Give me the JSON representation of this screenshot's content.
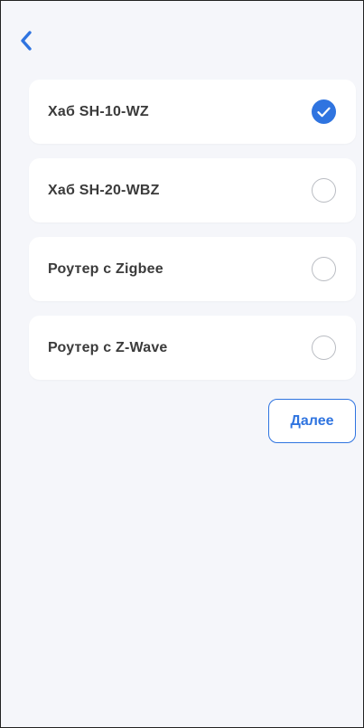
{
  "colors": {
    "accent": "#2f74e0",
    "background": "#f5f6fa",
    "card": "#ffffff",
    "text": "#3b3b3b"
  },
  "header": {
    "back_icon": "chevron-left-icon"
  },
  "options": [
    {
      "label": "Хаб SH-10-WZ",
      "selected": true
    },
    {
      "label": "Хаб SH-20-WBZ",
      "selected": false
    },
    {
      "label": "Роутер с Zigbee",
      "selected": false
    },
    {
      "label": "Роутер с Z-Wave",
      "selected": false
    }
  ],
  "actions": {
    "next_label": "Далее"
  }
}
